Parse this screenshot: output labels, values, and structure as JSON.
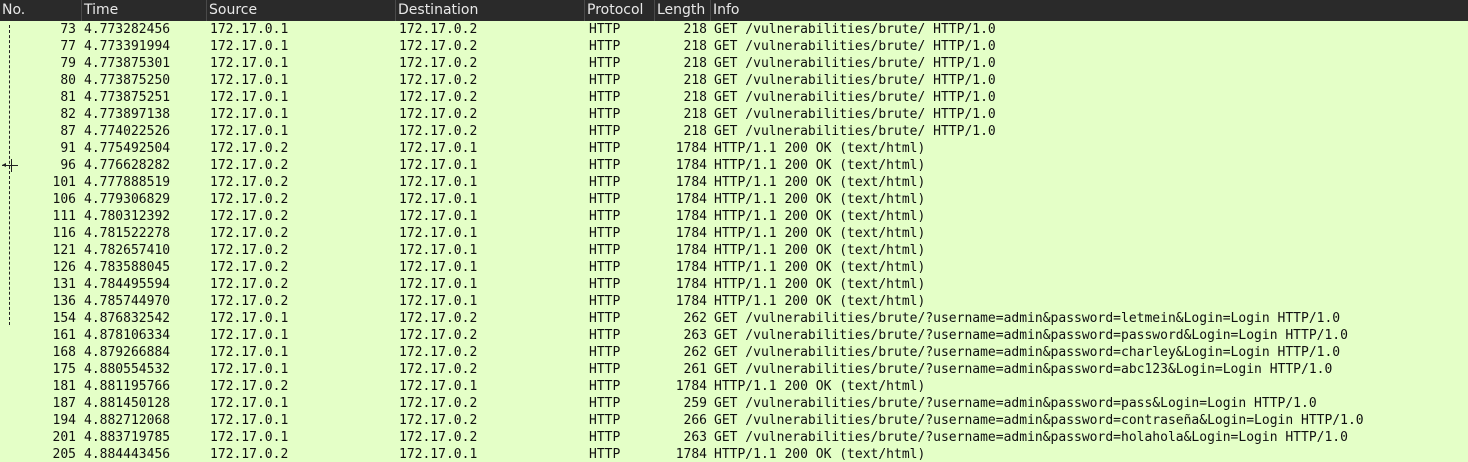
{
  "columns": {
    "no": "No.",
    "time": "Time",
    "source": "Source",
    "destination": "Destination",
    "protocol": "Protocol",
    "length": "Length",
    "info": "Info"
  },
  "colors": {
    "row_background": "#e4ffc7",
    "header_background": "#2a2a2a",
    "header_text": "#e8e8e8"
  },
  "packets": [
    {
      "no": "73",
      "time": "4.773282456",
      "source": "172.17.0.1",
      "destination": "172.17.0.2",
      "protocol": "HTTP",
      "length": "218",
      "info": "GET /vulnerabilities/brute/ HTTP/1.0"
    },
    {
      "no": "77",
      "time": "4.773391994",
      "source": "172.17.0.1",
      "destination": "172.17.0.2",
      "protocol": "HTTP",
      "length": "218",
      "info": "GET /vulnerabilities/brute/ HTTP/1.0"
    },
    {
      "no": "79",
      "time": "4.773875301",
      "source": "172.17.0.1",
      "destination": "172.17.0.2",
      "protocol": "HTTP",
      "length": "218",
      "info": "GET /vulnerabilities/brute/ HTTP/1.0"
    },
    {
      "no": "80",
      "time": "4.773875250",
      "source": "172.17.0.1",
      "destination": "172.17.0.2",
      "protocol": "HTTP",
      "length": "218",
      "info": "GET /vulnerabilities/brute/ HTTP/1.0"
    },
    {
      "no": "81",
      "time": "4.773875251",
      "source": "172.17.0.1",
      "destination": "172.17.0.2",
      "protocol": "HTTP",
      "length": "218",
      "info": "GET /vulnerabilities/brute/ HTTP/1.0"
    },
    {
      "no": "82",
      "time": "4.773897138",
      "source": "172.17.0.1",
      "destination": "172.17.0.2",
      "protocol": "HTTP",
      "length": "218",
      "info": "GET /vulnerabilities/brute/ HTTP/1.0"
    },
    {
      "no": "87",
      "time": "4.774022526",
      "source": "172.17.0.1",
      "destination": "172.17.0.2",
      "protocol": "HTTP",
      "length": "218",
      "info": "GET /vulnerabilities/brute/ HTTP/1.0"
    },
    {
      "no": "91",
      "time": "4.775492504",
      "source": "172.17.0.2",
      "destination": "172.17.0.1",
      "protocol": "HTTP",
      "length": "1784",
      "info": "HTTP/1.1 200 OK  (text/html)"
    },
    {
      "no": "96",
      "time": "4.776628282",
      "source": "172.17.0.2",
      "destination": "172.17.0.1",
      "protocol": "HTTP",
      "length": "1784",
      "info": "HTTP/1.1 200 OK  (text/html)"
    },
    {
      "no": "101",
      "time": "4.777888519",
      "source": "172.17.0.2",
      "destination": "172.17.0.1",
      "protocol": "HTTP",
      "length": "1784",
      "info": "HTTP/1.1 200 OK  (text/html)"
    },
    {
      "no": "106",
      "time": "4.779306829",
      "source": "172.17.0.2",
      "destination": "172.17.0.1",
      "protocol": "HTTP",
      "length": "1784",
      "info": "HTTP/1.1 200 OK  (text/html)"
    },
    {
      "no": "111",
      "time": "4.780312392",
      "source": "172.17.0.2",
      "destination": "172.17.0.1",
      "protocol": "HTTP",
      "length": "1784",
      "info": "HTTP/1.1 200 OK  (text/html)"
    },
    {
      "no": "116",
      "time": "4.781522278",
      "source": "172.17.0.2",
      "destination": "172.17.0.1",
      "protocol": "HTTP",
      "length": "1784",
      "info": "HTTP/1.1 200 OK  (text/html)"
    },
    {
      "no": "121",
      "time": "4.782657410",
      "source": "172.17.0.2",
      "destination": "172.17.0.1",
      "protocol": "HTTP",
      "length": "1784",
      "info": "HTTP/1.1 200 OK  (text/html)"
    },
    {
      "no": "126",
      "time": "4.783588045",
      "source": "172.17.0.2",
      "destination": "172.17.0.1",
      "protocol": "HTTP",
      "length": "1784",
      "info": "HTTP/1.1 200 OK  (text/html)"
    },
    {
      "no": "131",
      "time": "4.784495594",
      "source": "172.17.0.2",
      "destination": "172.17.0.1",
      "protocol": "HTTP",
      "length": "1784",
      "info": "HTTP/1.1 200 OK  (text/html)"
    },
    {
      "no": "136",
      "time": "4.785744970",
      "source": "172.17.0.2",
      "destination": "172.17.0.1",
      "protocol": "HTTP",
      "length": "1784",
      "info": "HTTP/1.1 200 OK  (text/html)"
    },
    {
      "no": "154",
      "time": "4.876832542",
      "source": "172.17.0.1",
      "destination": "172.17.0.2",
      "protocol": "HTTP",
      "length": "262",
      "info": "GET /vulnerabilities/brute/?username=admin&password=letmein&Login=Login HTTP/1.0"
    },
    {
      "no": "161",
      "time": "4.878106334",
      "source": "172.17.0.1",
      "destination": "172.17.0.2",
      "protocol": "HTTP",
      "length": "263",
      "info": "GET /vulnerabilities/brute/?username=admin&password=password&Login=Login HTTP/1.0"
    },
    {
      "no": "168",
      "time": "4.879266884",
      "source": "172.17.0.1",
      "destination": "172.17.0.2",
      "protocol": "HTTP",
      "length": "262",
      "info": "GET /vulnerabilities/brute/?username=admin&password=charley&Login=Login HTTP/1.0"
    },
    {
      "no": "175",
      "time": "4.880554532",
      "source": "172.17.0.1",
      "destination": "172.17.0.2",
      "protocol": "HTTP",
      "length": "261",
      "info": "GET /vulnerabilities/brute/?username=admin&password=abc123&Login=Login HTTP/1.0"
    },
    {
      "no": "181",
      "time": "4.881195766",
      "source": "172.17.0.2",
      "destination": "172.17.0.1",
      "protocol": "HTTP",
      "length": "1784",
      "info": "HTTP/1.1 200 OK  (text/html)"
    },
    {
      "no": "187",
      "time": "4.881450128",
      "source": "172.17.0.1",
      "destination": "172.17.0.2",
      "protocol": "HTTP",
      "length": "259",
      "info": "GET /vulnerabilities/brute/?username=admin&password=pass&Login=Login HTTP/1.0"
    },
    {
      "no": "194",
      "time": "4.882712068",
      "source": "172.17.0.1",
      "destination": "172.17.0.2",
      "protocol": "HTTP",
      "length": "266",
      "info": "GET /vulnerabilities/brute/?username=admin&password=contraseña&Login=Login HTTP/1.0"
    },
    {
      "no": "201",
      "time": "4.883719785",
      "source": "172.17.0.1",
      "destination": "172.17.0.2",
      "protocol": "HTTP",
      "length": "263",
      "info": "GET /vulnerabilities/brute/?username=admin&password=holahola&Login=Login HTTP/1.0"
    },
    {
      "no": "205",
      "time": "4.884443456",
      "source": "172.17.0.2",
      "destination": "172.17.0.1",
      "protocol": "HTTP",
      "length": "1784",
      "info": "HTTP/1.1 200 OK  (text/html)"
    }
  ]
}
